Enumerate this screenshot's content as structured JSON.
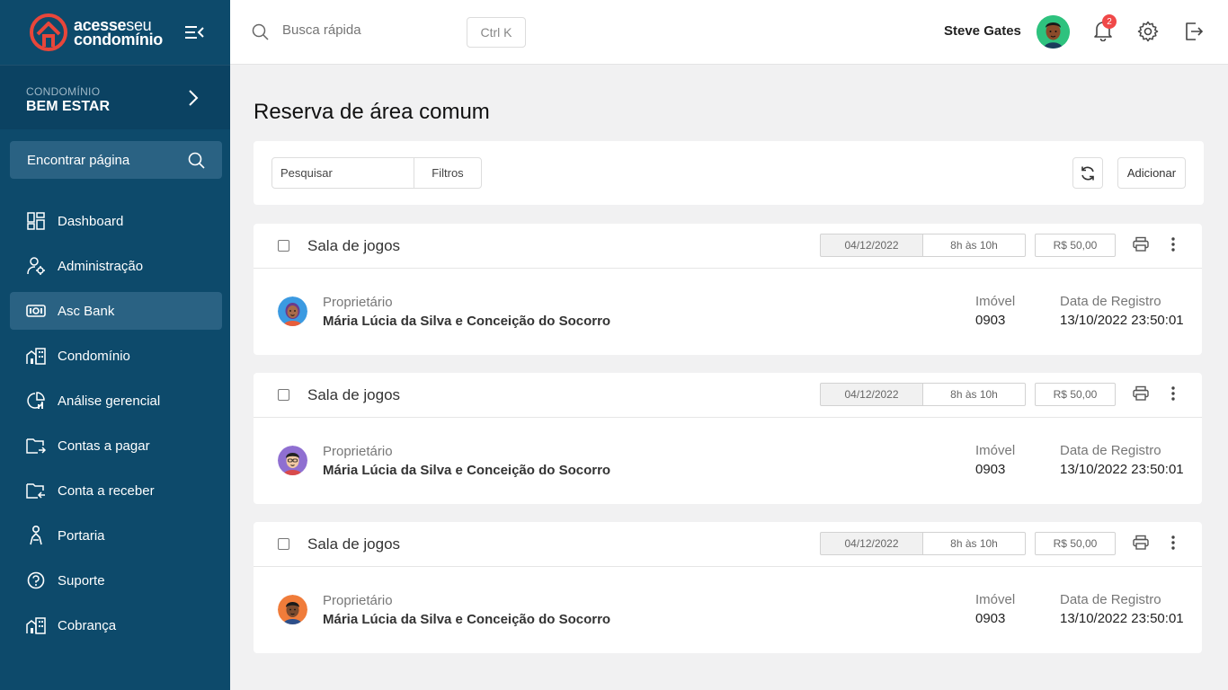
{
  "brand": {
    "line1_bold": "acesse",
    "line1_thin": "seu",
    "line2": "condomínio"
  },
  "sidebar": {
    "condo_label": "CONDOMÍNIO",
    "condo_name": "BEM ESTAR",
    "find_label": "Encontrar página",
    "items": [
      {
        "label": "Dashboard",
        "icon": "dashboard-icon"
      },
      {
        "label": "Administração",
        "icon": "admin-users-icon"
      },
      {
        "label": "Asc Bank",
        "icon": "bank-icon"
      },
      {
        "label": "Condomínio",
        "icon": "building-icon"
      },
      {
        "label": "Análise gerencial",
        "icon": "chart-icon"
      },
      {
        "label": "Contas a pagar",
        "icon": "folder-out-icon"
      },
      {
        "label": "Conta a receber",
        "icon": "folder-in-icon"
      },
      {
        "label": "Portaria",
        "icon": "doorman-icon"
      },
      {
        "label": "Suporte",
        "icon": "help-icon"
      },
      {
        "label": "Cobrança",
        "icon": "building-icon"
      }
    ]
  },
  "header": {
    "search_placeholder": "Busca rápida",
    "shortcut": "Ctrl K",
    "user_name": "Steve Gates",
    "notification_count": "2"
  },
  "main": {
    "title": "Reserva de área comum",
    "toolbar": {
      "search_label": "Pesquisar",
      "filters_label": "Filtros",
      "add_label": "Adicionar"
    },
    "reservations": [
      {
        "title": "Sala de jogos",
        "date": "04/12/2022",
        "time": "8h às 10h",
        "price": "R$ 50,00",
        "owner_label": "Proprietário",
        "owner": "Mária Lúcia da Silva e Conceição do Socorro",
        "unit_label": "Imóvel",
        "unit": "0903",
        "reg_label": "Data de Registro",
        "reg": "13/10/2022 23:50:01"
      },
      {
        "title": "Sala de jogos",
        "date": "04/12/2022",
        "time": "8h às 10h",
        "price": "R$ 50,00",
        "owner_label": "Proprietário",
        "owner": "Mária Lúcia da Silva e Conceição do Socorro",
        "unit_label": "Imóvel",
        "unit": "0903",
        "reg_label": "Data de Registro",
        "reg": "13/10/2022 23:50:01"
      },
      {
        "title": "Sala de jogos",
        "date": "04/12/2022",
        "time": "8h às 10h",
        "price": "R$ 50,00",
        "owner_label": "Proprietário",
        "owner": "Mária Lúcia da Silva e Conceição do Socorro",
        "unit_label": "Imóvel",
        "unit": "0903",
        "reg_label": "Data de Registro",
        "reg": "13/10/2022 23:50:01"
      }
    ]
  },
  "colors": {
    "sidebar": "#0d4a6b",
    "sidebar_active": "#2a6283",
    "accent_logo": "#e8463a",
    "badge": "#f04848"
  }
}
